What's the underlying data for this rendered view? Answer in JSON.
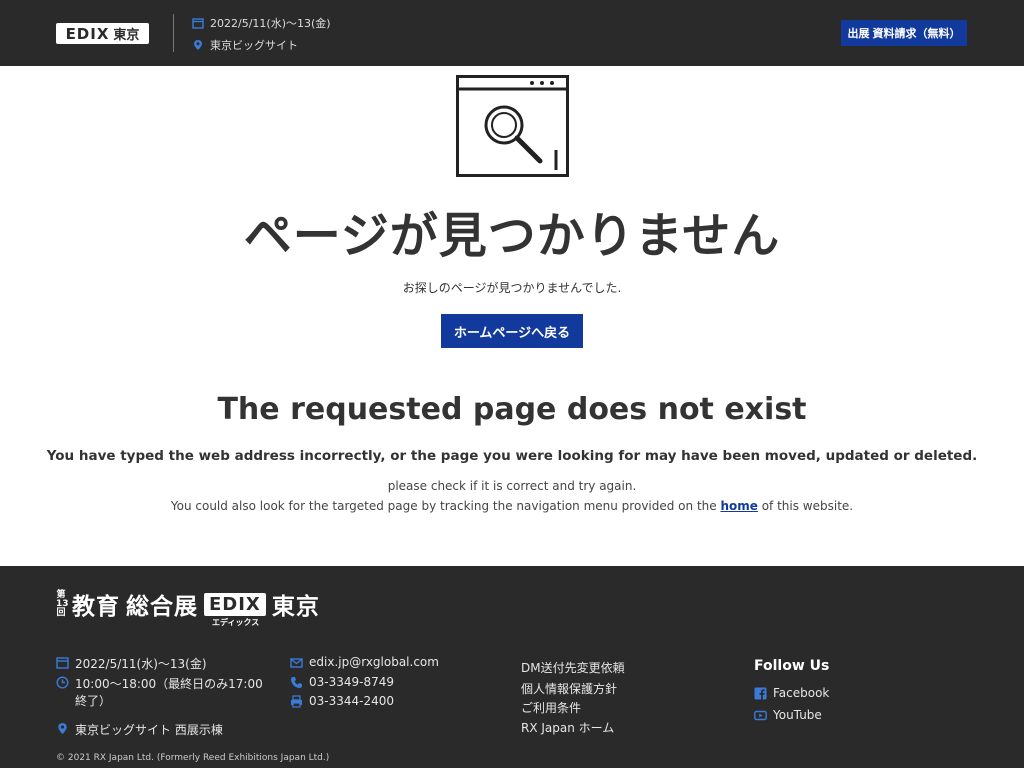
{
  "header": {
    "logo_text": "EDIX",
    "logo_city": "東京",
    "date": "2022/5/11(水)～13(金)",
    "venue": "東京ビッグサイト",
    "cta_label": "出展 資料請求（無料）"
  },
  "main": {
    "icon": "search-page-icon",
    "title_jp": "ページが見つかりません",
    "subtitle_jp": "お探しのページが見つかりませんでした.",
    "home_button_label": "ホームページへ戻る",
    "title_en": "The requested page does not exist",
    "description_en": "You have typed the web address incorrectly, or the page you were looking for may have been moved, updated or deleted.",
    "check_en": "please check if it is correct and try again.",
    "nav_prefix": "You could also look for the targeted page by tracking the navigation menu provided on the ",
    "nav_link": "home",
    "nav_suffix": " of this website."
  },
  "footer": {
    "logo": {
      "round_digits": "13",
      "round_prefix": "第",
      "round_suffix": "回",
      "name_part1": "教育",
      "name_part2": "総合展",
      "edix": "EDIX",
      "edix_kana": "エディックス",
      "city": "東京"
    },
    "date": "2022/5/11(水)～13(金)",
    "hours": "10:00～18:00（最終日のみ17:00終了）",
    "venue": "東京ビッグサイト 西展示棟",
    "email": "edix.jp@rxglobal.com",
    "phone": "03-3349-8749",
    "fax": "03-3344-2400",
    "links": [
      "DM送付先変更依頼",
      "個人情報保護方針",
      "ご利用条件",
      "RX Japan ホーム"
    ],
    "follow_title": "Follow Us",
    "social": [
      "Facebook",
      "YouTube"
    ],
    "copyright": "© 2021 RX Japan Ltd. (Formerly Reed Exhibitions Japan Ltd.)"
  },
  "colors": {
    "header_bg": "#2a2a2a",
    "accent": "#123a9c",
    "footer_bg": "#2a2a2a"
  }
}
